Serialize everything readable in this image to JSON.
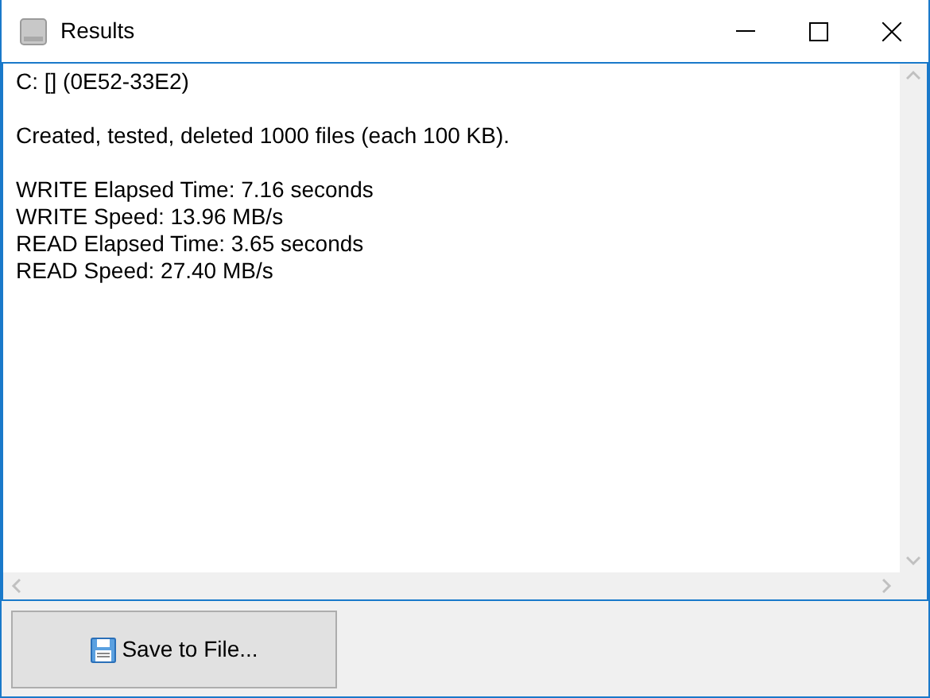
{
  "window": {
    "title": "Results"
  },
  "text_area": {
    "paragraphs": [
      [
        "C: [] (0E52-33E2)"
      ],
      [
        "Created, tested, deleted 1000 files (each 100 KB)."
      ],
      [
        "WRITE Elapsed Time: 7.16 seconds",
        "WRITE Speed: 13.96 MB/s",
        "READ Elapsed Time: 3.65 seconds",
        "READ Speed: 27.40 MB/s"
      ]
    ]
  },
  "buttons": [
    {
      "label": "Save to File..."
    }
  ]
}
